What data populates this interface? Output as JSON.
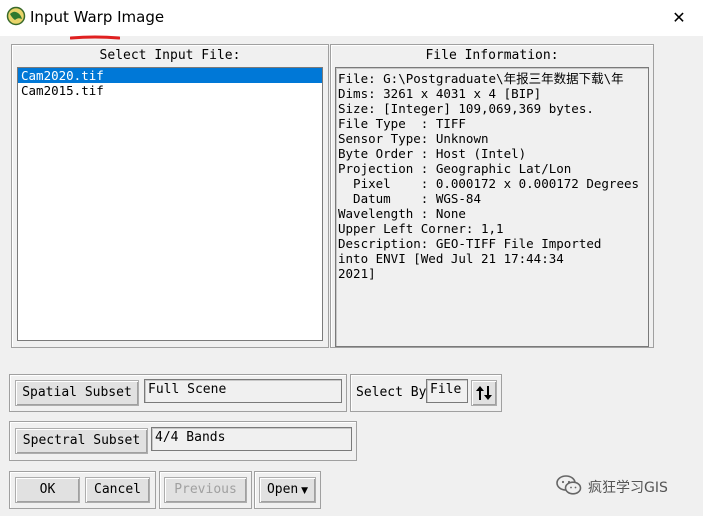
{
  "window": {
    "title": "Input Warp Image",
    "close_glyph": "✕",
    "accent": "#0078d7",
    "underline_color": "#e02020"
  },
  "select_panel": {
    "title": "Select Input File:",
    "files": [
      "Cam2020.tif",
      "Cam2015.tif"
    ],
    "selected_index": 0
  },
  "info_panel": {
    "title": "File Information:",
    "lines": [
      "File: G:\\Postgraduate\\年报三年数据下载\\年",
      "Dims: 3261 x 4031 x 4 [BIP]",
      "Size: [Integer] 109,069,369 bytes.",
      "File Type  : TIFF",
      "Sensor Type: Unknown",
      "Byte Order : Host (Intel)",
      "Projection : Geographic Lat/Lon",
      "  Pixel    : 0.000172 x 0.000172 Degrees",
      "  Datum    : WGS-84",
      "Wavelength : None",
      "Upper Left Corner: 1,1",
      "Description: GEO-TIFF File Imported",
      "into ENVI [Wed Jul 21 17:44:34",
      "2021]"
    ]
  },
  "spatial": {
    "button": "Spatial Subset",
    "value": "Full Scene"
  },
  "select_by": {
    "label": "Select By",
    "value": "File",
    "sort_icon": "sort-arrows-icon"
  },
  "spectral": {
    "button": "Spectral Subset",
    "value": "4/4 Bands"
  },
  "actions": {
    "ok": "OK",
    "cancel": "Cancel",
    "previous": "Previous",
    "open": "Open"
  },
  "watermark": {
    "text": "疯狂学习GIS",
    "icon": "wechat-icon"
  }
}
